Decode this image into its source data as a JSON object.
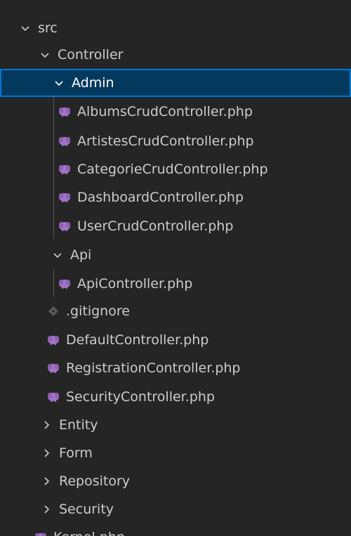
{
  "tree": {
    "src": {
      "label": "src"
    },
    "controller": {
      "label": "Controller"
    },
    "admin": {
      "label": "Admin"
    },
    "admin_files": [
      "AlbumsCrudController.php",
      "ArtistesCrudController.php",
      "CategorieCrudController.php",
      "DashboardController.php",
      "UserCrudController.php"
    ],
    "api": {
      "label": "Api"
    },
    "api_file": "ApiController.php",
    "gitignore": ".gitignore",
    "controller_files": [
      "DefaultController.php",
      "RegistrationController.php",
      "SecurityController.php"
    ],
    "collapsed_folders": [
      "Entity",
      "Form",
      "Repository",
      "Security"
    ],
    "kernel": "Kernel.php"
  },
  "colors": {
    "background": "#252526",
    "selection": "#04395e",
    "selection_border": "#0078d4",
    "php_icon": "#a074c4",
    "text": "#cccccc"
  },
  "icons": {
    "chevron_expanded": "chevron-down-icon",
    "chevron_collapsed": "chevron-right-icon",
    "php_file": "php-elephant-icon",
    "git_file": "git-diamond-icon"
  }
}
